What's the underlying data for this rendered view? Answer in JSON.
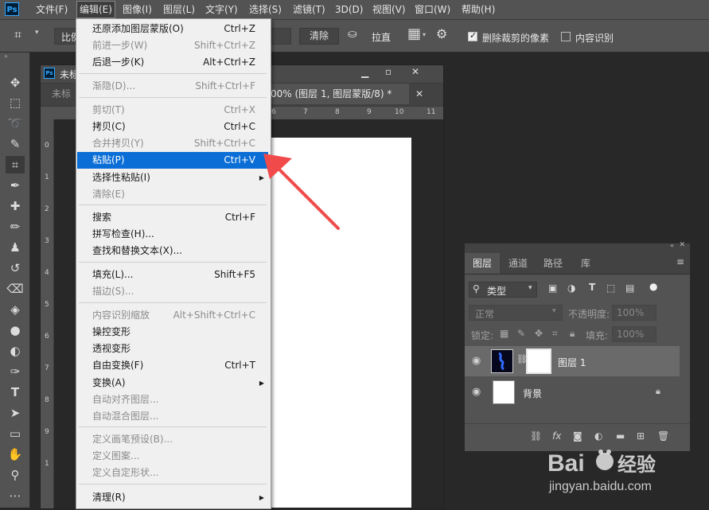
{
  "menubar": {
    "logo": "Ps",
    "items": [
      "文件(F)",
      "编辑(E)",
      "图像(I)",
      "图层(L)",
      "文字(Y)",
      "选择(S)",
      "滤镜(T)",
      "3D(D)",
      "视图(V)",
      "窗口(W)",
      "帮助(H)"
    ]
  },
  "options_bar": {
    "ratio_label": "比例",
    "clear_button": "清除",
    "straighten_label": "拉直",
    "delete_cropped_label": "删除裁剪的像素",
    "delete_cropped_checked": true,
    "content_aware_label": "内容识别",
    "content_aware_checked": false
  },
  "document": {
    "title_short": "未标",
    "tab_inactive": "未标",
    "tab_active": "00% (图层 1, 图层蒙版/8) *",
    "ruler_top_ticks": [
      "0",
      "1",
      "2",
      "3",
      "4",
      "5",
      "6",
      "7",
      "8",
      "9",
      "10",
      "11"
    ],
    "ruler_left_ticks": [
      "0",
      "1",
      "2",
      "3",
      "4",
      "5",
      "6",
      "7",
      "8",
      "9",
      "1"
    ]
  },
  "edit_menu": {
    "items": [
      {
        "label": "还原添加图层蒙版(O)",
        "shortcut": "Ctrl+Z",
        "disabled": false,
        "selected": false
      },
      {
        "label": "前进一步(W)",
        "shortcut": "Shift+Ctrl+Z",
        "disabled": true,
        "selected": false
      },
      {
        "label": "后退一步(K)",
        "shortcut": "Alt+Ctrl+Z",
        "disabled": false,
        "selected": false
      },
      {
        "label": "渐隐(D)...",
        "shortcut": "Shift+Ctrl+F",
        "disabled": true,
        "selected": false
      },
      {
        "label": "剪切(T)",
        "shortcut": "Ctrl+X",
        "disabled": true,
        "selected": false
      },
      {
        "label": "拷贝(C)",
        "shortcut": "Ctrl+C",
        "disabled": false,
        "selected": false
      },
      {
        "label": "合并拷贝(Y)",
        "shortcut": "Shift+Ctrl+C",
        "disabled": true,
        "selected": false
      },
      {
        "label": "粘贴(P)",
        "shortcut": "Ctrl+V",
        "disabled": false,
        "selected": true
      },
      {
        "label": "选择性粘贴(I)",
        "shortcut": "",
        "disabled": false,
        "selected": false,
        "submenu": true
      },
      {
        "label": "清除(E)",
        "shortcut": "",
        "disabled": true,
        "selected": false
      },
      {
        "label": "搜索",
        "shortcut": "Ctrl+F",
        "disabled": false,
        "selected": false
      },
      {
        "label": "拼写检查(H)...",
        "shortcut": "",
        "disabled": false,
        "selected": false
      },
      {
        "label": "查找和替换文本(X)...",
        "shortcut": "",
        "disabled": false,
        "selected": false
      },
      {
        "label": "填充(L)...",
        "shortcut": "Shift+F5",
        "disabled": false,
        "selected": false
      },
      {
        "label": "描边(S)...",
        "shortcut": "",
        "disabled": true,
        "selected": false
      },
      {
        "label": "内容识别缩放",
        "shortcut": "Alt+Shift+Ctrl+C",
        "disabled": true,
        "selected": false
      },
      {
        "label": "操控变形",
        "shortcut": "",
        "disabled": false,
        "selected": false
      },
      {
        "label": "透视变形",
        "shortcut": "",
        "disabled": false,
        "selected": false
      },
      {
        "label": "自由变换(F)",
        "shortcut": "Ctrl+T",
        "disabled": false,
        "selected": false
      },
      {
        "label": "变换(A)",
        "shortcut": "",
        "disabled": false,
        "selected": false,
        "submenu": true
      },
      {
        "label": "自动对齐图层...",
        "shortcut": "",
        "disabled": true,
        "selected": false
      },
      {
        "label": "自动混合图层...",
        "shortcut": "",
        "disabled": true,
        "selected": false
      },
      {
        "label": "定义画笔预设(B)...",
        "shortcut": "",
        "disabled": true,
        "selected": false
      },
      {
        "label": "定义图案...",
        "shortcut": "",
        "disabled": true,
        "selected": false
      },
      {
        "label": "定义自定形状...",
        "shortcut": "",
        "disabled": true,
        "selected": false
      },
      {
        "label": "清理(R)",
        "shortcut": "",
        "disabled": false,
        "selected": false,
        "submenu": true
      }
    ]
  },
  "layers_panel": {
    "tabs": [
      "图层",
      "通道",
      "路径",
      "库"
    ],
    "filter_kind": "类型",
    "blend_mode": "正常",
    "opacity_label": "不透明度:",
    "opacity_value": "100%",
    "lock_label": "锁定:",
    "fill_label": "填充:",
    "fill_value": "100%",
    "layers": [
      {
        "name": "图层 1",
        "has_mask": true,
        "locked": false
      },
      {
        "name": "背景",
        "has_mask": false,
        "locked": true
      }
    ]
  },
  "watermark": {
    "brand": "Bai",
    "brand_suffix": "经验",
    "url": "jingyan.baidu.com"
  },
  "colors": {
    "menu_highlight": "#0a6ed6",
    "arrow": "#f04a4a",
    "ps_blue": "#31a8ff"
  }
}
